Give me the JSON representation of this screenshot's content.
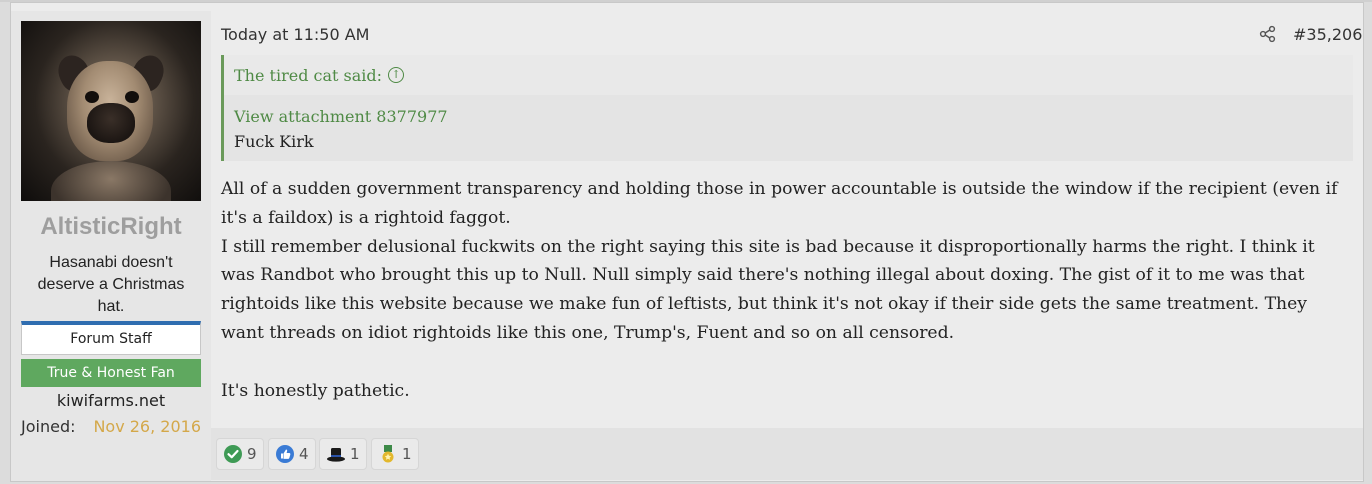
{
  "user": {
    "name": "AltisticRight",
    "title": "Hasanabi doesn't deserve a Christmas hat.",
    "banners": [
      "Forum Staff",
      "True & Honest Fan"
    ],
    "site": "kiwifarms.net",
    "joined_label": "Joined:",
    "joined_value": "Nov 26, 2016"
  },
  "post": {
    "date": "Today at 11:50 AM",
    "number": "#35,206",
    "quote": {
      "header": "The tired cat said:",
      "attachment": "View attachment 8377977",
      "text": "Fuck Kirk"
    },
    "paragraphs": [
      "All of a sudden government transparency and holding those in power accountable is outside the window if the recipient (even if it's a faildox) is a rightoid faggot.",
      "I still remember delusional fuckwits on the right saying this site is bad because it disproportionally harms the right. I think it was Randbot who brought this up to Null. Null simply said there's nothing illegal about doxing. The gist of it to me was that rightoids like this website because we make fun of leftists, but think it's not okay if their side gets the same treatment. They want threads on idiot rightoids like this one, Trump's, Fuent and so on all censored.",
      "It's honestly pathetic."
    ]
  },
  "reactions": [
    {
      "icon": "check-icon",
      "count": "9"
    },
    {
      "icon": "thumbs-up-icon",
      "count": "4"
    },
    {
      "icon": "top-hat-icon",
      "count": "1"
    },
    {
      "icon": "medal-icon",
      "count": "1"
    }
  ],
  "colors": {
    "quote_green": "#4f8a45",
    "staff_blue": "#2f6db0",
    "fan_green": "#5fa85f",
    "joined_gold": "#d4a84a"
  }
}
